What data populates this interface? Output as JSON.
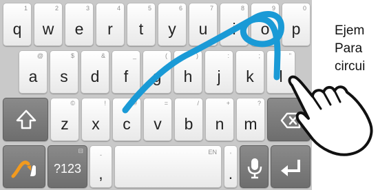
{
  "keyboard": {
    "rows": [
      [
        {
          "label": "q",
          "hint": "1"
        },
        {
          "label": "w",
          "hint": "2"
        },
        {
          "label": "e",
          "hint": "3"
        },
        {
          "label": "r",
          "hint": "4"
        },
        {
          "label": "t",
          "hint": "5"
        },
        {
          "label": "y",
          "hint": "6"
        },
        {
          "label": "u",
          "hint": "7"
        },
        {
          "label": "i",
          "hint": "8"
        },
        {
          "label": "o",
          "hint": "9"
        },
        {
          "label": "p",
          "hint": "0"
        }
      ],
      [
        {
          "label": "a",
          "hint": "@"
        },
        {
          "label": "s",
          "hint": "$"
        },
        {
          "label": "d",
          "hint": "&"
        },
        {
          "label": "f",
          "hint": "_"
        },
        {
          "label": "g",
          "hint": "("
        },
        {
          "label": "h",
          "hint": ")"
        },
        {
          "label": "j",
          "hint": ":"
        },
        {
          "label": "k",
          "hint": ";"
        },
        {
          "label": "l",
          "hint": "\""
        }
      ],
      [
        {
          "label": "z",
          "hint": "©"
        },
        {
          "label": "x",
          "hint": "!"
        },
        {
          "label": "c",
          "hint": "#"
        },
        {
          "label": "v",
          "hint": "="
        },
        {
          "label": "b",
          "hint": "/"
        },
        {
          "label": "n",
          "hint": "+"
        },
        {
          "label": "m",
          "hint": "?"
        }
      ]
    ],
    "shift_icon": "shift-arrow-icon",
    "backspace_icon": "backspace-icon",
    "swype_icon": "swype-logo-icon",
    "symbols_label": "?123",
    "symbols_hint": "⊟",
    "comma_label": ",",
    "comma_hint": "-",
    "space_hint": "EN",
    "period_label": ".",
    "period_hint": "'",
    "mic_icon": "microphone-icon",
    "enter_icon": "enter-arrow-icon"
  },
  "gesture": {
    "color": "#1a9ad6",
    "word_traced": "cogli"
  },
  "caption": {
    "line1": "Ejem",
    "line2": "Para",
    "line3": "circui"
  },
  "hand_icon": "pointing-hand-icon"
}
